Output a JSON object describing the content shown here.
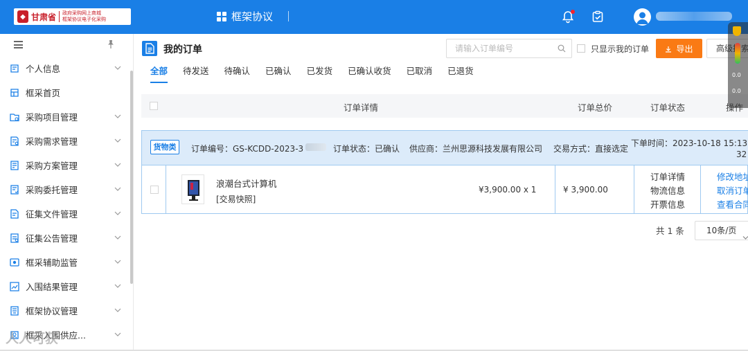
{
  "header": {
    "logo_name": "甘肃省",
    "logo_line1": "政府采购网上商城",
    "logo_line2": "框架协议电子化采购",
    "app_title": "框架协议"
  },
  "sidebar": {
    "items": [
      {
        "label": "个人信息",
        "has_children": true
      },
      {
        "label": "框采首页",
        "has_children": false
      },
      {
        "label": "采购项目管理",
        "has_children": true
      },
      {
        "label": "采购需求管理",
        "has_children": true
      },
      {
        "label": "采购方案管理",
        "has_children": true
      },
      {
        "label": "采购委托管理",
        "has_children": true
      },
      {
        "label": "征集文件管理",
        "has_children": true
      },
      {
        "label": "征集公告管理",
        "has_children": true
      },
      {
        "label": "框采辅助监管",
        "has_children": true
      },
      {
        "label": "入围结果管理",
        "has_children": true
      },
      {
        "label": "框架协议管理",
        "has_children": true
      },
      {
        "label": "框采入围供应...",
        "has_children": true
      }
    ]
  },
  "main": {
    "page_title": "我的订单",
    "search_placeholder": "请输入订单编号",
    "only_mine_label": "只显示我的订单",
    "export_label": "导出",
    "advanced_search_label": "高级搜索",
    "tabs": [
      "全部",
      "待发送",
      "待确认",
      "已确认",
      "已发货",
      "已确认收货",
      "已取消",
      "已退货"
    ],
    "active_tab": 0,
    "columns": {
      "detail": "订单详情",
      "total": "订单总价",
      "status": "订单状态",
      "action": "操作"
    }
  },
  "order": {
    "badge": "货物类",
    "order_no": "订单编号：GS-KCDD-2023-3",
    "status": "订单状态：已确认",
    "supplier": "供应商：兰州思源科技发展有限公司",
    "trade_mode": "交易方式：直接选定",
    "order_time": "下单时间：2023-10-18 15:13:",
    "order_time_tail": "32",
    "product_name": "浪潮台式计算机",
    "snapshot": "[交易快照]",
    "unit_price": "¥3,900.00 x 1",
    "total_price": "¥ 3,900.00",
    "status_links": [
      "订单详情",
      "物流信息",
      "开票信息"
    ],
    "action_links": [
      "修改地址",
      "取消订单",
      "查看合同"
    ]
  },
  "pager": {
    "total": "共 1 条",
    "page_size": "10条/页"
  },
  "widget": {
    "up_rate": "0.0",
    "down_rate": "0.0"
  },
  "watermark": "人人可获"
}
